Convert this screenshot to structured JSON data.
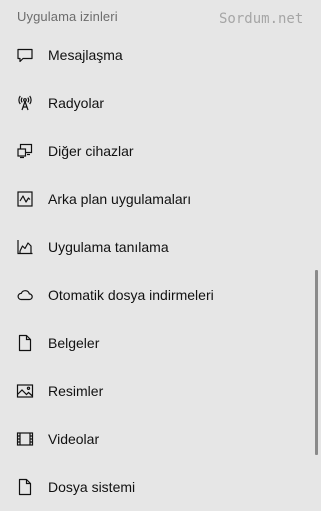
{
  "section": {
    "title": "Uygulama izinleri"
  },
  "watermark": "Sordum.net",
  "nav": {
    "items": [
      {
        "label": "Mesajlaşma",
        "icon": "message-icon"
      },
      {
        "label": "Radyolar",
        "icon": "radio-antenna-icon"
      },
      {
        "label": "Diğer cihazlar",
        "icon": "devices-icon"
      },
      {
        "label": "Arka plan uygulamaları",
        "icon": "background-apps-icon"
      },
      {
        "label": "Uygulama tanılama",
        "icon": "diagnostics-chart-icon"
      },
      {
        "label": "Otomatik dosya indirmeleri",
        "icon": "cloud-icon"
      },
      {
        "label": "Belgeler",
        "icon": "document-icon"
      },
      {
        "label": "Resimler",
        "icon": "picture-icon"
      },
      {
        "label": "Videolar",
        "icon": "video-icon"
      },
      {
        "label": "Dosya sistemi",
        "icon": "file-system-icon"
      }
    ]
  }
}
